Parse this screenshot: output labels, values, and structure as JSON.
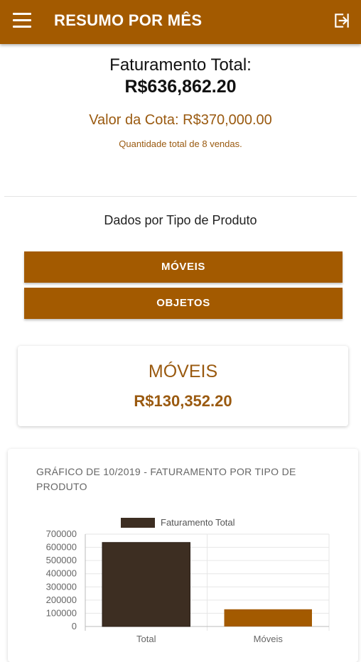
{
  "appbar": {
    "title": "RESUMO POR MÊS",
    "menu_icon": "menu-icon",
    "logout_icon": "logout-icon",
    "color": "#a35a00"
  },
  "summary": {
    "total_label": "Faturamento Total:",
    "total_value": "R$636,862.20",
    "quota": "Valor da Cota: R$370,000.00",
    "sales_count": "Quantidade total de 8 vendas."
  },
  "section": {
    "title": "Dados por Tipo de Produto"
  },
  "buttons": {
    "moveis": "MÓVEIS",
    "objetos": "OBJETOS"
  },
  "card": {
    "title": "MÓVEIS",
    "value": "R$130,352.20"
  },
  "chart": {
    "title": "GRÁFICO DE 10/2019 - FATURAMENTO POR TIPO DE PRODUTO"
  },
  "chart_data": {
    "type": "bar",
    "title": "GRÁFICO DE 10/2019 - FATURAMENTO POR TIPO DE PRODUTO",
    "legend": [
      "Faturamento Total"
    ],
    "legend_position": "top",
    "categories": [
      "Total",
      "Móveis"
    ],
    "values": [
      636862.2,
      130352.2
    ],
    "colors": [
      "#3d2e22",
      "#a35a00"
    ],
    "ylim": [
      0,
      700000
    ],
    "yticks": [
      "700000",
      "600000",
      "500000",
      "400000",
      "300000",
      "200000",
      "100000",
      "0"
    ],
    "grid": true
  }
}
